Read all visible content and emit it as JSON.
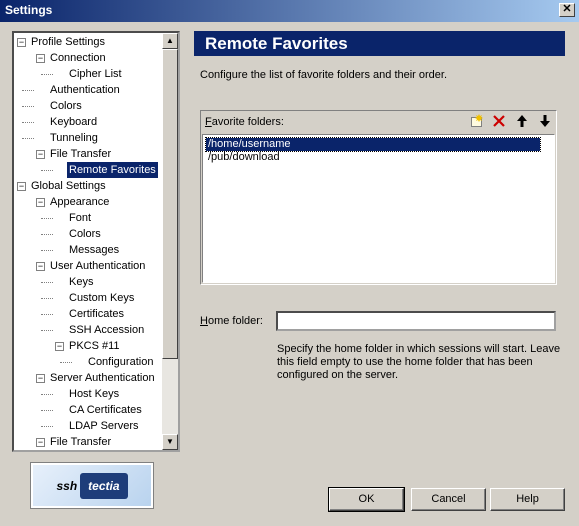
{
  "window": {
    "title": "Settings",
    "close_label": "✕"
  },
  "tree": {
    "items": [
      {
        "label": "Profile Settings",
        "level": 0,
        "expander": "−"
      },
      {
        "label": "Connection",
        "level": 1,
        "expander": "−"
      },
      {
        "label": "Cipher List",
        "level": 2
      },
      {
        "label": "Authentication",
        "level": 1
      },
      {
        "label": "Colors",
        "level": 1
      },
      {
        "label": "Keyboard",
        "level": 1
      },
      {
        "label": "Tunneling",
        "level": 1
      },
      {
        "label": "File Transfer",
        "level": 1,
        "expander": "−"
      },
      {
        "label": "Remote Favorites",
        "level": 2,
        "selected": true
      },
      {
        "label": "Global Settings",
        "level": 0,
        "expander": "−"
      },
      {
        "label": "Appearance",
        "level": 1,
        "expander": "−"
      },
      {
        "label": "Font",
        "level": 2
      },
      {
        "label": "Colors",
        "level": 2
      },
      {
        "label": "Messages",
        "level": 2
      },
      {
        "label": "User Authentication",
        "level": 1,
        "expander": "−"
      },
      {
        "label": "Keys",
        "level": 2
      },
      {
        "label": "Custom Keys",
        "level": 2
      },
      {
        "label": "Certificates",
        "level": 2
      },
      {
        "label": "SSH Accession",
        "level": 2
      },
      {
        "label": "PKCS #11",
        "level": 2,
        "expander": "−"
      },
      {
        "label": "Configuration",
        "level": 3
      },
      {
        "label": "Server Authentication",
        "level": 1,
        "expander": "−"
      },
      {
        "label": "Host Keys",
        "level": 2
      },
      {
        "label": "CA Certificates",
        "level": 2
      },
      {
        "label": "LDAP Servers",
        "level": 2
      },
      {
        "label": "File Transfer",
        "level": 1,
        "expander": "−"
      }
    ]
  },
  "logo": {
    "ssh": "ssh",
    "tectia": "tectia"
  },
  "panel": {
    "title": "Remote Favorites",
    "description": "Configure the list of favorite folders and their order.",
    "favorites_label_accel": "F",
    "favorites_label_rest": "avorite folders:",
    "favorites": [
      "/home/username",
      "/pub/download"
    ],
    "selected_index": 0,
    "home_label_accel": "H",
    "home_label_rest": "ome folder:",
    "home_value": "",
    "help_text": "Specify the home folder in which sessions will start. Leave this field empty to use the home folder that has been configured on the server."
  },
  "buttons": {
    "ok": "OK",
    "cancel": "Cancel",
    "help": "Help"
  },
  "colors": {
    "selection": "#0a246a",
    "face": "#d4d0c8",
    "delete_icon": "#cc0000"
  }
}
